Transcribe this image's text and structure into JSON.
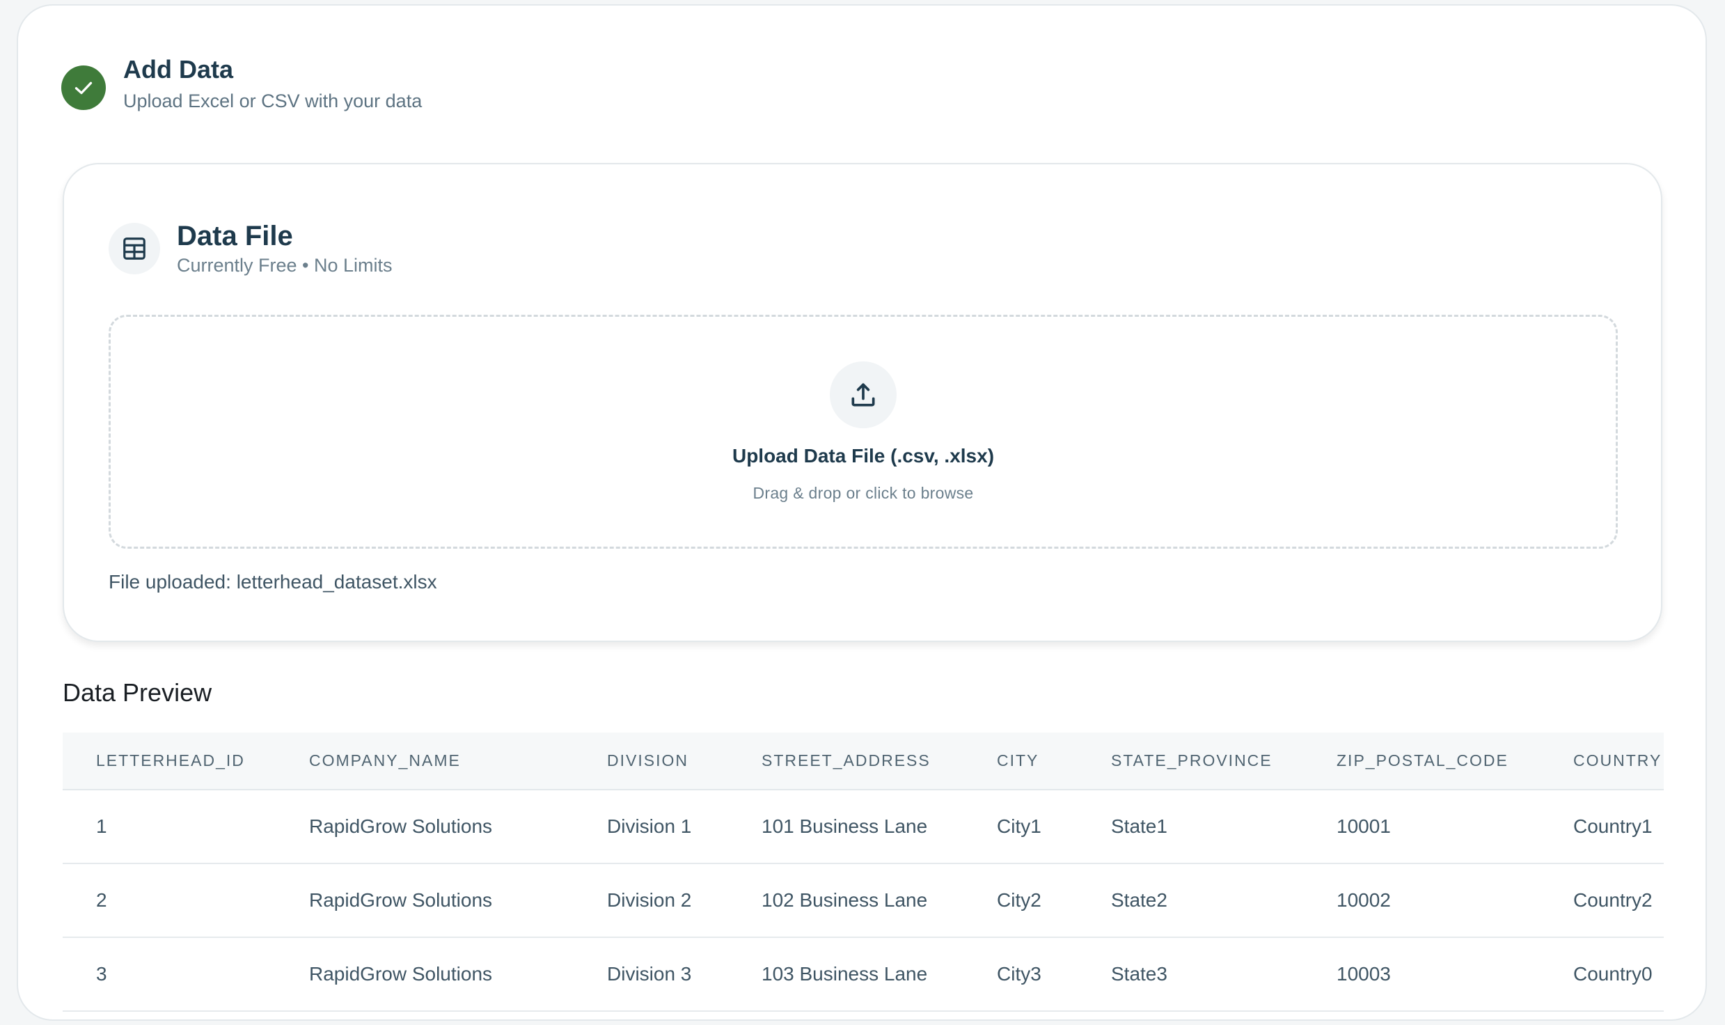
{
  "step": {
    "title": "Add Data",
    "subtitle": "Upload Excel or CSV with your data"
  },
  "data_file": {
    "title": "Data File",
    "subtitle": "Currently Free • No Limits",
    "upload_title": "Upload Data File (.csv, .xlsx)",
    "upload_hint": "Drag & drop or click to browse",
    "status_prefix": "File uploaded: ",
    "file_name": "letterhead_dataset.xlsx"
  },
  "preview": {
    "title": "Data Preview",
    "columns": [
      "LETTERHEAD_ID",
      "COMPANY_NAME",
      "DIVISION",
      "STREET_ADDRESS",
      "CITY",
      "STATE_PROVINCE",
      "ZIP_POSTAL_CODE",
      "COUNTRY"
    ],
    "rows": [
      [
        "1",
        "RapidGrow Solutions",
        "Division 1",
        "101 Business Lane",
        "City1",
        "State1",
        "10001",
        "Country1"
      ],
      [
        "2",
        "RapidGrow Solutions",
        "Division 2",
        "102 Business Lane",
        "City2",
        "State2",
        "10002",
        "Country2"
      ],
      [
        "3",
        "RapidGrow Solutions",
        "Division 3",
        "103 Business Lane",
        "City3",
        "State3",
        "10003",
        "Country0"
      ]
    ]
  },
  "colors": {
    "accent_green": "#3f7b3a",
    "heading": "#1e3a4c"
  },
  "icons": {
    "step_status": "check-icon",
    "file_card": "table-icon",
    "dropzone": "upload-icon"
  }
}
